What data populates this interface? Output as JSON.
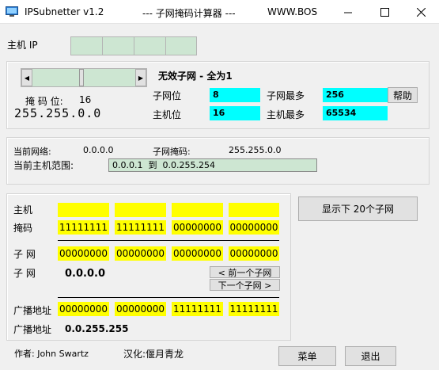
{
  "window": {
    "app_title": "IPSubnetter v1.2",
    "subtitle": "--- 子网掩码计算器 ---",
    "site": "WWW.BOS"
  },
  "host_ip": {
    "label": "主机 IP",
    "octets": [
      "",
      "",
      "",
      ""
    ]
  },
  "mask_panel": {
    "mask_bits_label": "掩 码 位:",
    "mask_bits_value": "16",
    "mask_value": "255.255.0.0",
    "invalid_subnet_text": "无效子网 - 全为1",
    "subnet_bits_label": "子网位",
    "subnet_bits_value": "8",
    "host_bits_label": "主机位",
    "host_bits_value": "16",
    "max_subnets_label": "子网最多",
    "max_subnets_value": "256",
    "max_hosts_label": "主机最多",
    "max_hosts_value": "65534",
    "help_button": "帮助"
  },
  "current": {
    "network_label": "当前网络:",
    "network_value": "0.0.0.0",
    "subnet_mask_label": "子网掩码:",
    "subnet_mask_value": "255.255.0.0",
    "host_range_label": "当前主机范围:",
    "host_range_value": "0.0.0.1  到  0.0.255.254"
  },
  "binary": {
    "host_label": "主机",
    "mask_label": "掩码",
    "mask_bits": [
      "11111111",
      "11111111",
      "00000000",
      "00000000"
    ],
    "subnet_label": "子 网",
    "subnet_bits": [
      "00000000",
      "00000000",
      "00000000",
      "00000000"
    ],
    "subnet_label2": "子 网",
    "subnet_value": "0.0.0.0",
    "prev_subnet_button": "< 前一个子网",
    "next_subnet_button": "下一个子网 >",
    "broadcast_label": "广播地址",
    "broadcast_bits": [
      "00000000",
      "00000000",
      "11111111",
      "11111111"
    ],
    "broadcast_label2": "广播地址",
    "broadcast_value": "0.0.255.255"
  },
  "show_subnets_button": "显示下 20个子网",
  "footer": {
    "author": "作者: John Swartz",
    "localizer": "汉化:偃月青龙",
    "menu_button": "菜单",
    "exit_button": "退出"
  }
}
